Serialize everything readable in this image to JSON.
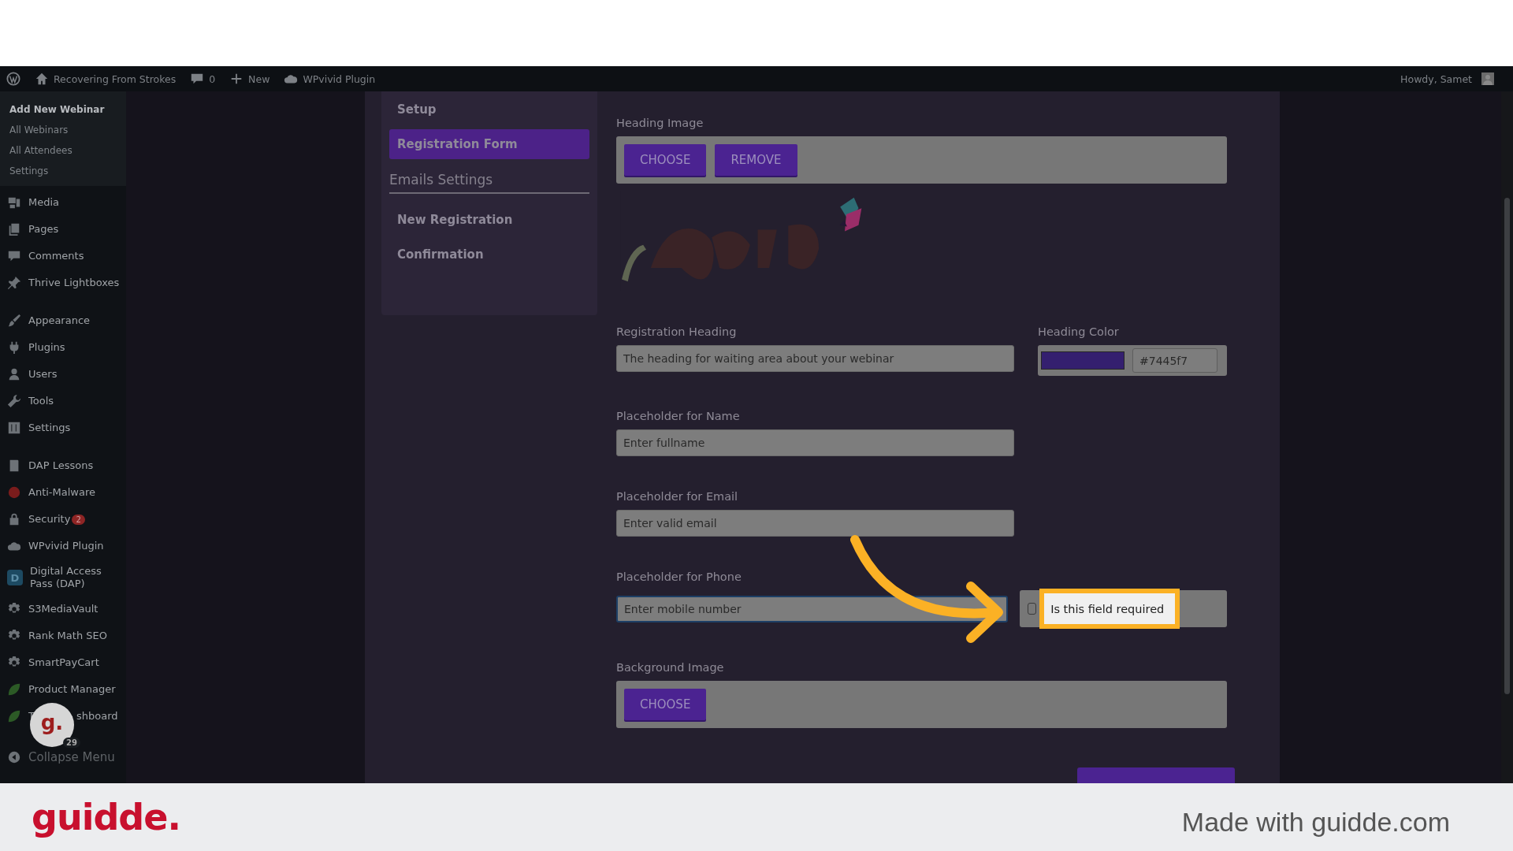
{
  "admin_bar": {
    "site": "Recovering From Strokes",
    "comments": "0",
    "new": "New",
    "plugin": "WPvivid Plugin",
    "greeting": "Howdy, Samet"
  },
  "sidebar": {
    "submenu": [
      {
        "label": "Add New Webinar",
        "selected": true
      },
      {
        "label": "All Webinars",
        "selected": false
      },
      {
        "label": "All Attendees",
        "selected": false
      },
      {
        "label": "Settings",
        "selected": false
      }
    ],
    "groups": [
      [
        {
          "label": "Media"
        },
        {
          "label": "Pages"
        },
        {
          "label": "Comments"
        },
        {
          "label": "Thrive Lightboxes"
        }
      ],
      [
        {
          "label": "Appearance"
        },
        {
          "label": "Plugins"
        },
        {
          "label": "Users"
        },
        {
          "label": "Tools"
        },
        {
          "label": "Settings"
        }
      ],
      [
        {
          "label": "DAP Lessons"
        },
        {
          "label": "Anti-Malware"
        },
        {
          "label": "Security",
          "badge": "2"
        },
        {
          "label": "WPvivid Plugin"
        },
        {
          "label": "Digital Access Pass (DAP)",
          "icon_letter": "D"
        },
        {
          "label": "S3MediaVault"
        },
        {
          "label": "Rank Math SEO"
        },
        {
          "label": "SmartPayCart"
        },
        {
          "label": "Product Manager"
        },
        {
          "label": "T",
          "label_end": "shboard"
        }
      ]
    ],
    "collapse": "Collapse Menu"
  },
  "settings_nav": {
    "items": [
      {
        "label": "Setup",
        "selected": false
      },
      {
        "label": "Registration Form",
        "selected": true
      }
    ],
    "section": "Emails Settings",
    "email_items": [
      {
        "label": "New Registration",
        "selected": false
      },
      {
        "label": "Confirmation",
        "selected": false
      }
    ]
  },
  "form": {
    "heading_image": {
      "label": "Heading Image",
      "buttons": [
        "CHOOSE",
        "REMOVE"
      ],
      "preview": {
        "kind": "picture"
      }
    },
    "registration_heading": {
      "label": "Registration Heading",
      "value": "The heading for waiting area about your webinar"
    },
    "heading_color": {
      "label": "Heading Color",
      "value": "#7445f7"
    },
    "name": {
      "label": "Placeholder for Name",
      "value": "Enter fullname"
    },
    "email": {
      "label": "Placeholder for Email",
      "value": "Enter valid email"
    },
    "phone": {
      "label": "Placeholder for Phone",
      "value": "Enter mobile number",
      "focused": true,
      "required_label": "Is this field required",
      "required": false
    },
    "background_image": {
      "label": "Background Image",
      "buttons": [
        "CHOOSE"
      ]
    }
  },
  "overlay": {
    "bubble": "g.",
    "bubble_count": "29"
  },
  "footer": {
    "logo": "guidde.",
    "credit": "Made with guidde.com"
  }
}
